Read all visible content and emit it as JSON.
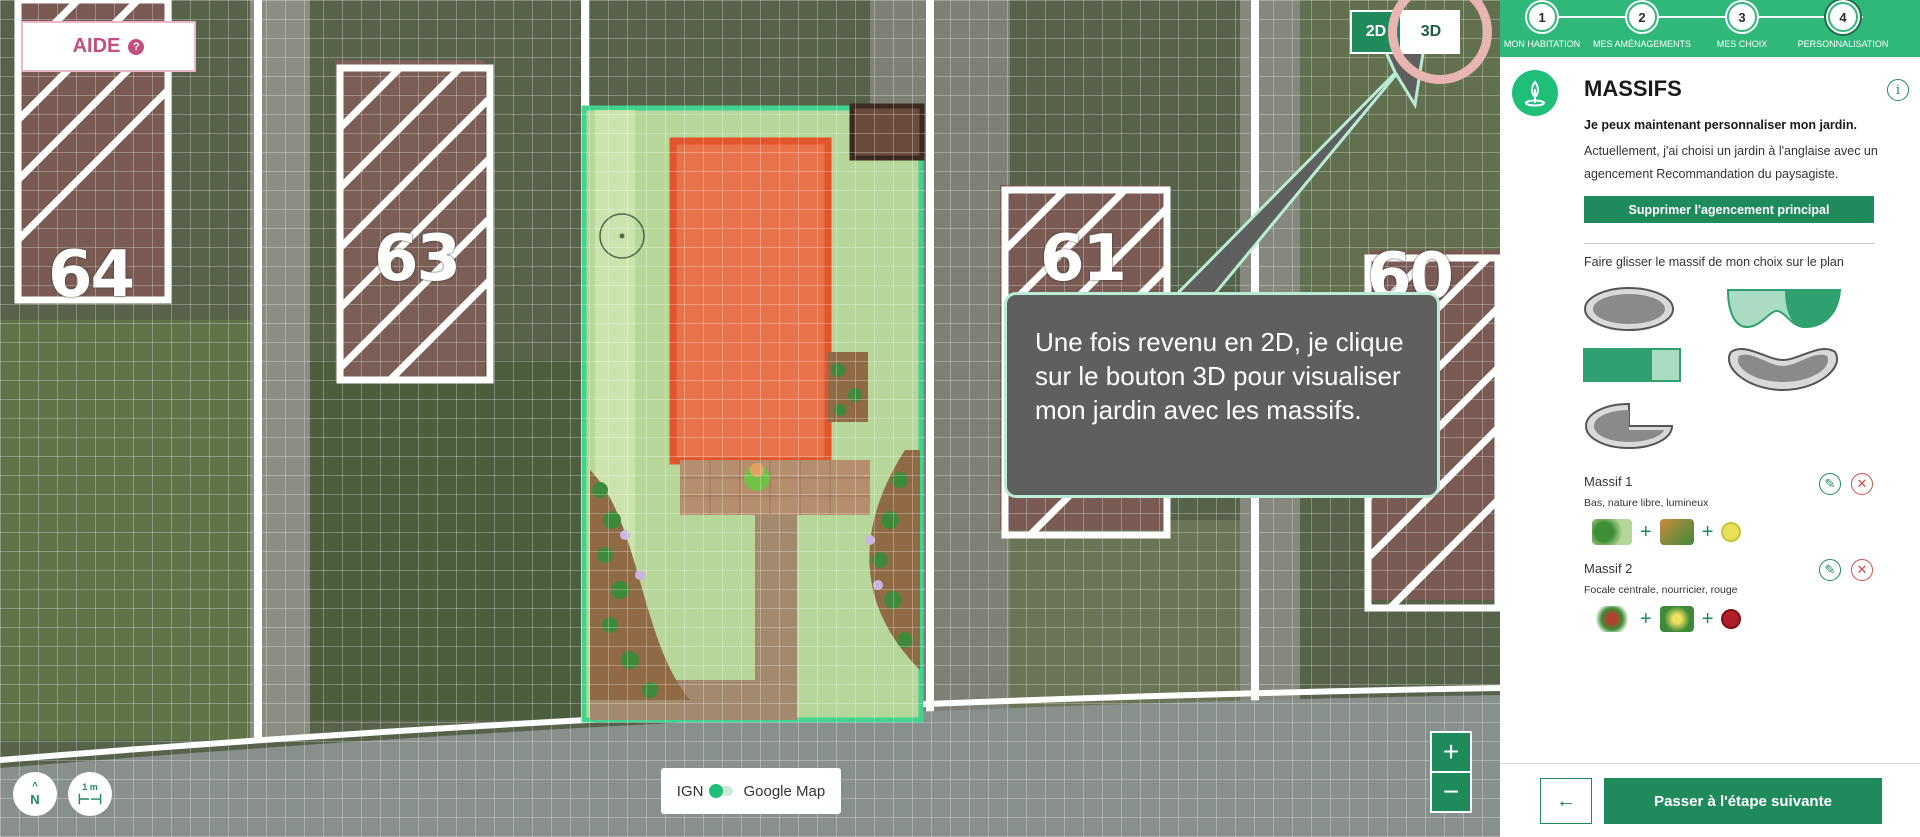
{
  "help": {
    "label": "AIDE",
    "icon": "question-icon"
  },
  "map": {
    "lot_numbers": [
      "64",
      "63",
      "61",
      "60"
    ],
    "view_toggle": {
      "btn_2d": "2D",
      "btn_3d": "3D"
    },
    "tooltip": "Une fois revenu en 2D, je clique sur le bouton 3D pour visualiser mon jardin avec les massifs.",
    "compass_label": "N",
    "scale_label": "1 m",
    "layer_switch": {
      "left": "IGN",
      "right": "Google Map"
    },
    "zoom_in": "+",
    "zoom_out": "−"
  },
  "stepper": {
    "steps": [
      {
        "number": "1",
        "label": "MON HABITATION"
      },
      {
        "number": "2",
        "label": "MES AMÉNAGEMENTS"
      },
      {
        "number": "3",
        "label": "MES CHOIX"
      },
      {
        "number": "4",
        "label": "PERSONNALISATION"
      }
    ],
    "active_step": 4
  },
  "panel": {
    "title": "MASSIFS",
    "info_icon": "i",
    "intro_strong": "Je peux maintenant personnaliser mon jardin.",
    "intro_text": "Actuellement, j'ai choisi un jardin à l'anglaise avec un agencement Recommandation du paysagiste.",
    "delete_button": "Supprimer l'agencement principal",
    "drag_hint": "Faire glisser le massif de mon choix sur le plan",
    "massifs": [
      {
        "title": "Massif 1",
        "subtitle": "Bas, nature libre, lumineux"
      },
      {
        "title": "Massif 2",
        "subtitle": "Focale centrale, nourricier, rouge"
      }
    ],
    "plus": "+",
    "back_arrow": "←",
    "next_button": "Passer à l'étape suivante"
  },
  "colors": {
    "brand_green": "#1f8a5c",
    "stepper_green": "#2fb87a",
    "help_pink": "#c14f7f",
    "tooltip_bg": "#5f5f5f",
    "house_orange": "#e8734a"
  }
}
